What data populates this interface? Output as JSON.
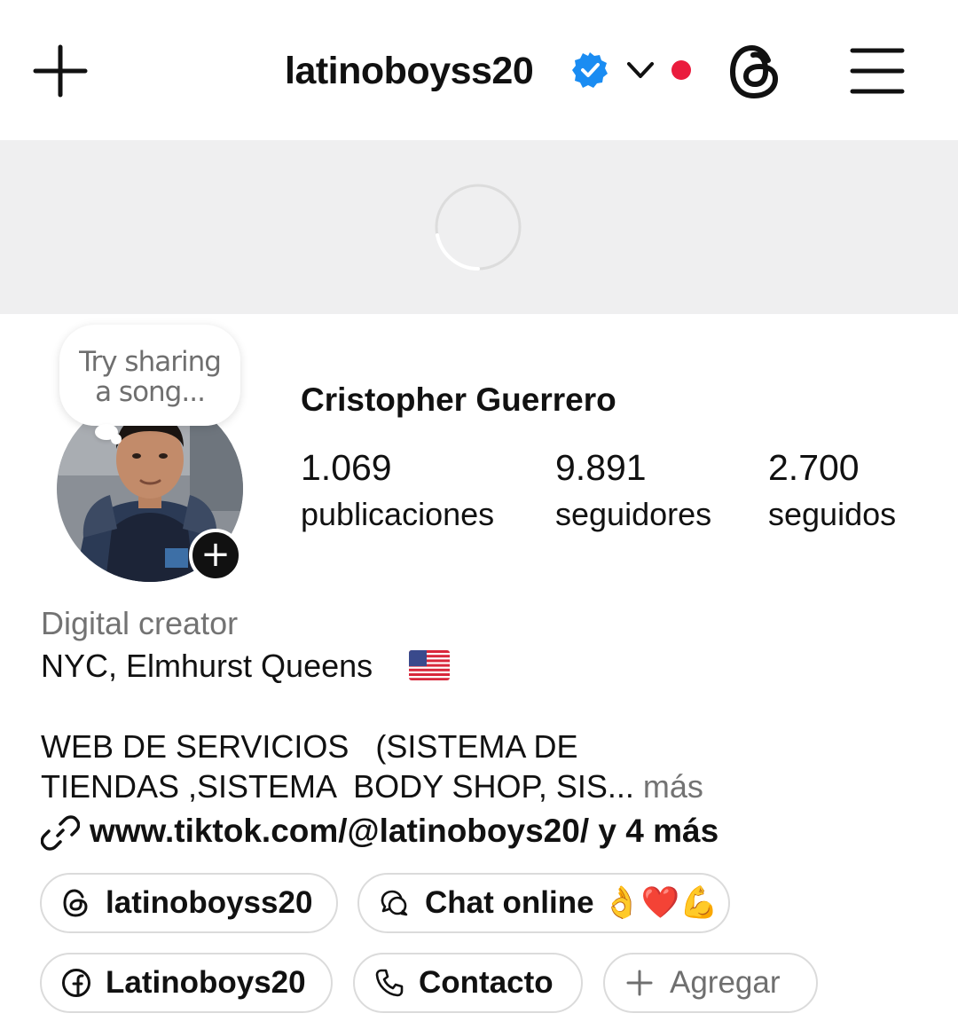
{
  "header": {
    "username": "latinoboyss20",
    "verified": true,
    "notification_dot_color": "#ea1c3d",
    "icons": [
      "add-icon",
      "verified-icon",
      "chevron-down-icon",
      "threads-icon",
      "menu-icon"
    ]
  },
  "banner": {
    "state": "loading",
    "background": "#efeff0"
  },
  "note": {
    "line1": "Try sharing",
    "line2": "a song..."
  },
  "profile": {
    "name": "Cristopher Guerrero",
    "stats": {
      "posts": {
        "value": "1.069",
        "label": "publicaciones"
      },
      "followers": {
        "value": "9.891",
        "label": "seguidores"
      },
      "following": {
        "value": "2.700",
        "label": "seguidos"
      }
    }
  },
  "bio": {
    "category": "Digital creator",
    "location": "NYC, Elmhurst Queens",
    "location_flag": "us-flag",
    "line1": "WEB DE SERVICIOS   (SISTEMA DE",
    "line2": "TIENDAS ,SISTEMA  BODY SHOP, SIS...",
    "more_label": "más",
    "link": "www.tiktok.com/@latinoboys20/ y 4 más"
  },
  "buttons": {
    "threads": {
      "label": "latinoboyss20",
      "icon": "threads-icon"
    },
    "chat": {
      "label": "Chat online 👌❤️💪",
      "icon": "chat-bubbles-icon"
    },
    "facebook": {
      "label": "Latinoboys20",
      "icon": "facebook-icon"
    },
    "contact": {
      "label": "Contacto",
      "icon": "phone-icon"
    },
    "add": {
      "label": "Agregar",
      "icon": "plus-icon"
    }
  }
}
